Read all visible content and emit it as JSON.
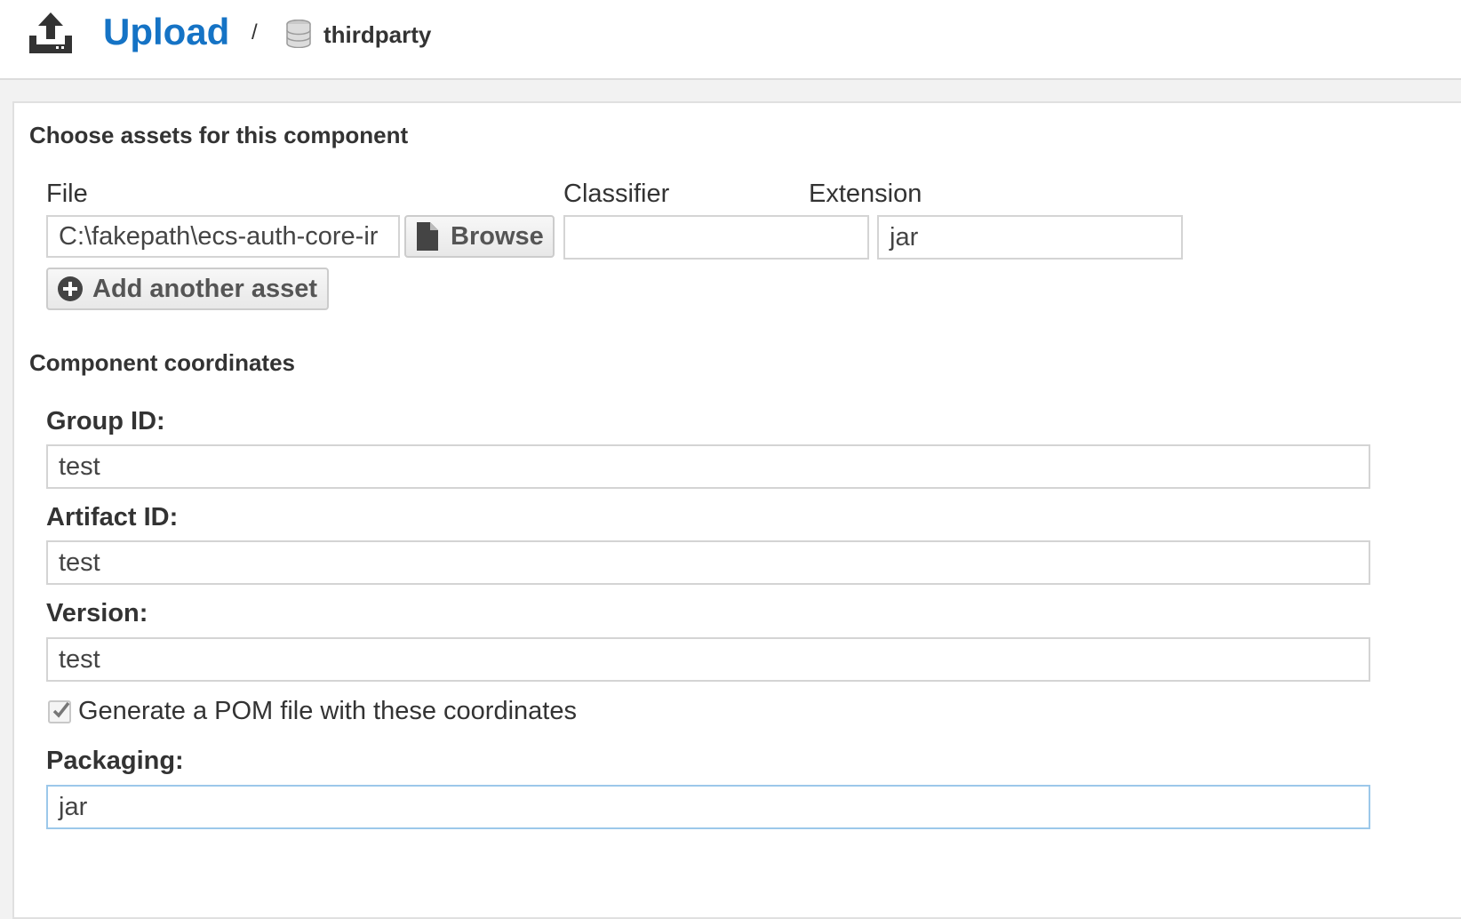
{
  "header": {
    "title": "Upload",
    "separator": "/",
    "repository": "thirdparty",
    "upload_icon": "upload-icon",
    "repo_icon": "database-icon"
  },
  "assets_section": {
    "title": "Choose assets for this component",
    "file_label": "File",
    "classifier_label": "Classifier",
    "extension_label": "Extension",
    "file_value": "C:\\fakepath\\ecs-auth-core-ir",
    "browse_label": "Browse",
    "classifier_value": "",
    "extension_value": "jar",
    "add_asset_label": "Add another asset"
  },
  "coords_section": {
    "title": "Component coordinates",
    "group_label": "Group ID:",
    "group_value": "test",
    "artifact_label": "Artifact ID:",
    "artifact_value": "test",
    "version_label": "Version:",
    "version_value": "test",
    "generate_pom_label": "Generate a POM file with these coordinates",
    "generate_pom_checked": true,
    "packaging_label": "Packaging:",
    "packaging_value": "jar"
  },
  "colors": {
    "accent": "#1573c5",
    "focus_border": "#9cc8ea"
  }
}
